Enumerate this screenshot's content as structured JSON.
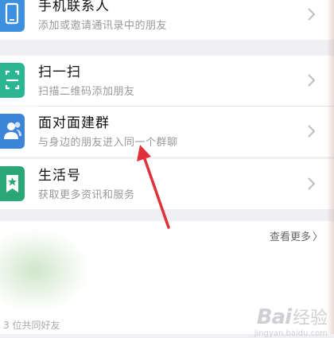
{
  "rows": [
    {
      "title": "手机联系人",
      "subtitle": "添加或邀请通讯录中的朋友",
      "icon": "phone-icon"
    },
    {
      "title": "扫一扫",
      "subtitle": "扫描二维码添加朋友",
      "icon": "scan-icon"
    },
    {
      "title": "面对面建群",
      "subtitle": "与身边的朋友进入同一个群聊",
      "icon": "people-icon"
    },
    {
      "title": "生活号",
      "subtitle": "获取更多资讯和服务",
      "icon": "life-account-icon"
    }
  ],
  "more": {
    "label": "查看更多",
    "arrow": "〉"
  },
  "common_friends": "3 位共同好友",
  "watermark": {
    "brand": "Bai",
    "brand_cn": "经验",
    "url": "jingyan.baidu.com"
  },
  "colors": {
    "phone_icon": "#3d8fe0",
    "scan_icon": "#2bb592",
    "people_icon": "#3b84d8",
    "life_icon": "#2aa774",
    "annotation_arrow": "#e0313a"
  }
}
